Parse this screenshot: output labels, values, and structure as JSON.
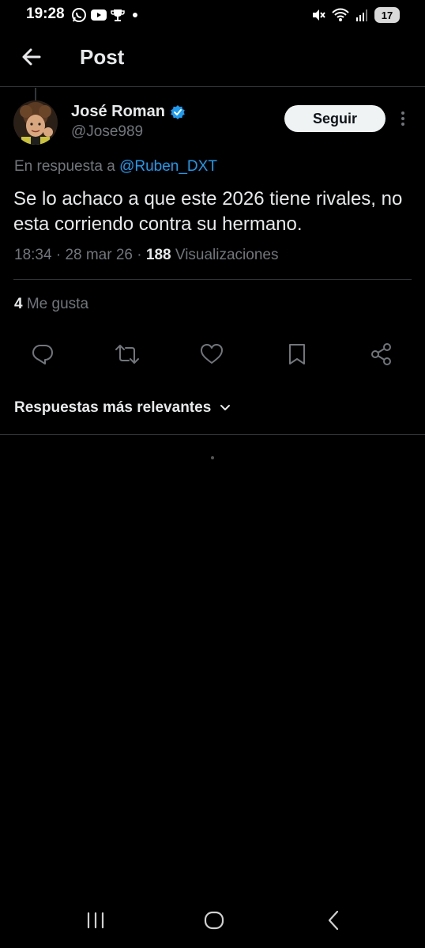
{
  "status_bar": {
    "time": "19:28",
    "left_icons": [
      "whatsapp-icon",
      "youtube-icon",
      "trophy-icon",
      "dot-icon"
    ],
    "right_icons": [
      "mute-icon",
      "wifi-icon",
      "signal-icon"
    ],
    "battery": "17"
  },
  "header": {
    "title": "Post"
  },
  "post": {
    "author_name": "José Roman",
    "verified": true,
    "handle": "@Jose989",
    "follow_label": "Seguir",
    "reply_prefix": "En respuesta a",
    "reply_mention": "@Ruben_DXT",
    "text": "Se lo achaco a que este 2026 tiene rivales, no esta corriendo contra su hermano.",
    "time": "18:34",
    "date": "28 mar 26",
    "views_count": "188",
    "views_label": "Visualizaciones",
    "likes_count": "4",
    "likes_label": "Me gusta"
  },
  "actions": [
    "reply-icon",
    "retweet-icon",
    "like-icon",
    "bookmark-icon",
    "share-icon"
  ],
  "replies": {
    "sort_label": "Respuestas más relevantes"
  },
  "colors": {
    "background": "#000000",
    "text": "#e7e9ea",
    "muted": "#71767b",
    "accent": "#1d9bf0",
    "divider": "#2f3336"
  }
}
